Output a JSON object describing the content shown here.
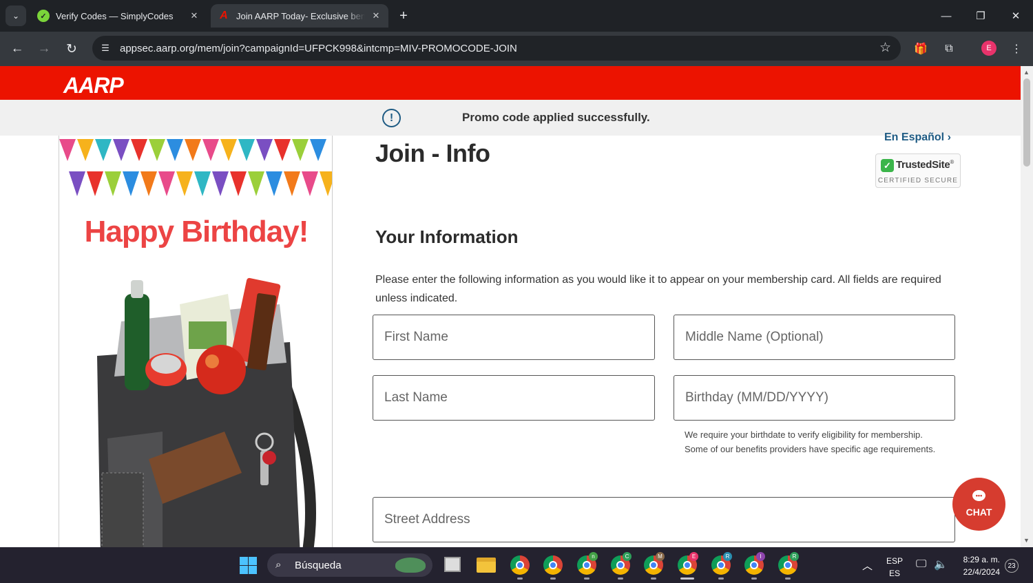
{
  "browser": {
    "tabs": [
      {
        "title": "Verify Codes — SimplyCodes",
        "active": false
      },
      {
        "title": "Join AARP Today- Exclusive benefits",
        "active": true
      }
    ],
    "url": "appsec.aarp.org/mem/join?campaignId=UFPCK998&intcmp=MIV-PROMOCODE-JOIN",
    "profile_initial": "E"
  },
  "header": {
    "logo_text": "AARP",
    "brand_color": "#ec1300"
  },
  "promo_banner": {
    "message": "Promo code applied successfully.",
    "icon": "info-circle-icon"
  },
  "promo_card": {
    "headline": "Happy Birthday!"
  },
  "language_link": "En Español ›",
  "page_title": "Join - Info",
  "trusted_site": {
    "name": "TrustedSite",
    "mark": "®",
    "subtitle": "CERTIFIED SECURE"
  },
  "section": {
    "title": "Your Information",
    "instructions": "Please enter the following information as you would like it to appear on your membership card. All fields are required unless indicated."
  },
  "fields": {
    "first_name": "First Name",
    "middle_name": "Middle Name (Optional)",
    "last_name": "Last Name",
    "birthday": "Birthday (MM/DD/YYYY)",
    "birthday_help": "We require your birthdate to verify eligibility for membership. Some of our benefits providers have specific age requirements.",
    "street_address": "Street Address"
  },
  "chat": {
    "label": "CHAT"
  },
  "taskbar": {
    "search_placeholder": "Búsqueda",
    "lang_top": "ESP",
    "lang_bottom": "ES",
    "time": "8:29 a. m.",
    "date": "22/4/2024",
    "notifications": "23",
    "chrome_badges": [
      "n",
      "C",
      "M",
      "E",
      "R",
      "I",
      "R"
    ]
  }
}
